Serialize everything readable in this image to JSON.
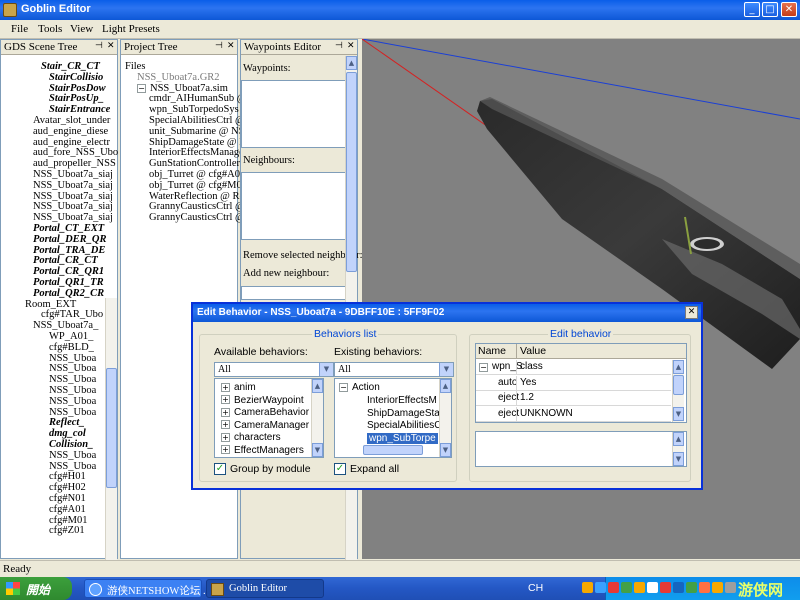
{
  "window": {
    "title": "Goblin Editor",
    "minimize": "_",
    "maximize": "□",
    "close": "✕"
  },
  "menu": [
    "File",
    "Tools",
    "View",
    "Light Presets"
  ],
  "scene_tree": {
    "title": "GDS Scene Tree",
    "items": [
      {
        "text": "Stair_CR_CT",
        "style": "bi",
        "indent": 1
      },
      {
        "text": "StairCollisio",
        "style": "bi",
        "indent": 2
      },
      {
        "text": "StairPosDow",
        "style": "bi",
        "indent": 2
      },
      {
        "text": "StairPosUp_",
        "style": "bi",
        "indent": 2
      },
      {
        "text": "StairEntrance",
        "style": "bi",
        "indent": 2
      },
      {
        "text": "Avatar_slot_under",
        "style": "n",
        "indent": 0
      },
      {
        "text": "aud_engine_diese",
        "style": "n",
        "indent": 0
      },
      {
        "text": "aud_engine_electr",
        "style": "n",
        "indent": 0
      },
      {
        "text": "aud_fore_NSS_Ubo",
        "style": "n",
        "indent": 0
      },
      {
        "text": "aud_propeller_NSS",
        "style": "n",
        "indent": 0
      },
      {
        "text": "NSS_Uboat7a_siaj",
        "style": "n",
        "indent": 0
      },
      {
        "text": "NSS_Uboat7a_siaj",
        "style": "n",
        "indent": 0
      },
      {
        "text": "NSS_Uboat7a_siaj",
        "style": "n",
        "indent": 0
      },
      {
        "text": "NSS_Uboat7a_siaj",
        "style": "n",
        "indent": 0
      },
      {
        "text": "NSS_Uboat7a_siaj",
        "style": "n",
        "indent": 0
      },
      {
        "text": "Portal_CT_EXT",
        "style": "bi",
        "indent": 0
      },
      {
        "text": "Portal_DER_QR",
        "style": "bi",
        "indent": 0
      },
      {
        "text": "Portal_TRA_DE",
        "style": "bi",
        "indent": 0
      },
      {
        "text": "Portal_CR_CT",
        "style": "bi",
        "indent": 0
      },
      {
        "text": "Portal_CR_QR1",
        "style": "bi",
        "indent": 0
      },
      {
        "text": "Portal_QR1_TR",
        "style": "bi",
        "indent": 0
      },
      {
        "text": "Portal_QR2_CR",
        "style": "bi",
        "indent": 0
      },
      {
        "text": "Room_EXT",
        "style": "n",
        "indent": -1
      },
      {
        "text": "cfg#TAR_Ubo",
        "style": "n",
        "indent": 1
      },
      {
        "text": "NSS_Uboat7a_",
        "style": "n",
        "indent": 0
      },
      {
        "text": "WP_A01_",
        "style": "n",
        "indent": 2
      },
      {
        "text": "cfg#BLD_",
        "style": "n",
        "indent": 2
      },
      {
        "text": "NSS_Uboa",
        "style": "n",
        "indent": 2
      },
      {
        "text": "NSS_Uboa",
        "style": "n",
        "indent": 2
      },
      {
        "text": "NSS_Uboa",
        "style": "n",
        "indent": 2
      },
      {
        "text": "NSS_Uboa",
        "style": "n",
        "indent": 2
      },
      {
        "text": "NSS_Uboa",
        "style": "n",
        "indent": 2
      },
      {
        "text": "NSS_Uboa",
        "style": "n",
        "indent": 2
      },
      {
        "text": "Reflect_",
        "style": "bi",
        "indent": 2
      },
      {
        "text": "dmg_col",
        "style": "bi",
        "indent": 2
      },
      {
        "text": "Collision_",
        "style": "bi",
        "indent": 2
      },
      {
        "text": "NSS_Uboa",
        "style": "n",
        "indent": 2
      },
      {
        "text": "NSS_Uboa",
        "style": "n",
        "indent": 2
      },
      {
        "text": "cfg#H01",
        "style": "n",
        "indent": 2
      },
      {
        "text": "cfg#H02",
        "style": "n",
        "indent": 2
      },
      {
        "text": "cfg#N01",
        "style": "n",
        "indent": 2
      },
      {
        "text": "cfg#A01",
        "style": "n",
        "indent": 2
      },
      {
        "text": "cfg#M01",
        "style": "n",
        "indent": 2
      },
      {
        "text": "cfg#Z01",
        "style": "n",
        "indent": 2
      }
    ]
  },
  "project_tree": {
    "title": "Project Tree",
    "items": [
      {
        "text": "Files",
        "indent": 0,
        "color": "#000"
      },
      {
        "text": "NSS_Uboat7a.GR2",
        "indent": 1,
        "color": "#7a7a7a"
      },
      {
        "text": "NSS_Uboat7a.sim",
        "indent": 1,
        "color": "#000",
        "toggle": "−"
      },
      {
        "text": "cmdr_AIHumanSub @",
        "indent": 2,
        "color": "#000"
      },
      {
        "text": "wpn_SubTorpedoSys",
        "indent": 2,
        "color": "#000"
      },
      {
        "text": "SpecialAbilitiesCtrl @",
        "indent": 2,
        "color": "#000"
      },
      {
        "text": "unit_Submarine @ NS",
        "indent": 2,
        "color": "#000"
      },
      {
        "text": "ShipDamageState @ N",
        "indent": 2,
        "color": "#000"
      },
      {
        "text": "InteriorEffectsManage",
        "indent": 2,
        "color": "#000"
      },
      {
        "text": "GunStationControllerI",
        "indent": 2,
        "color": "#000"
      },
      {
        "text": "obj_Turret @ cfg#A01",
        "indent": 2,
        "color": "#000"
      },
      {
        "text": "obj_Turret @ cfg#M01",
        "indent": 2,
        "color": "#000"
      },
      {
        "text": "WaterReflection @ Re",
        "indent": 2,
        "color": "#000"
      },
      {
        "text": "GrannyCausticsCtrl @",
        "indent": 2,
        "color": "#000"
      },
      {
        "text": "GrannyCausticsCtrl @",
        "indent": 2,
        "color": "#000"
      }
    ]
  },
  "waypoints": {
    "title": "Waypoints Editor",
    "waypoints_label": "Waypoints:",
    "neighbours_label": "Neighbours:",
    "remove_label": "Remove selected neighbour:",
    "add_label": "Add new neighbour:"
  },
  "dialog": {
    "title": "Edit Behavior - NSS_Uboat7a - 9DBFF10E : 5FF9F02",
    "behaviors_list_label": "Behaviors list",
    "available_label": "Available behaviors:",
    "existing_label": "Existing behaviors:",
    "available_filter": "All",
    "existing_filter": "All",
    "available_items": [
      "anim",
      "BezierWaypoint",
      "CameraBehavior",
      "CameraManager",
      "characters",
      "EffectManagers"
    ],
    "existing_group": "Action",
    "existing_items": [
      "InteriorEffectsM",
      "ShipDamageSta",
      "SpecialAbilitiesC",
      "wpn_SubTorpe"
    ],
    "group_by_module": "Group by module",
    "expand_all": "Expand all",
    "edit_behavior_label": "Edit behavior",
    "grid_headers": [
      "Name",
      "Value"
    ],
    "grid_rows": [
      {
        "name": "wpn_S",
        "value": "class"
      },
      {
        "name": "auto",
        "value": "Yes"
      },
      {
        "name": "eject",
        "value": "1.2"
      },
      {
        "name": "eject",
        "value": "UNKNOWN"
      }
    ]
  },
  "status": "Ready",
  "taskbar": {
    "start": "開始",
    "tasks": [
      "游侠NETSHOW论坛 ...",
      "Goblin Editor"
    ],
    "tray_lang": "CH",
    "watermark": "游侠网"
  },
  "colors": {
    "titlebar": "#0a5ee8",
    "viewport_bg": "#818181",
    "selected": "#316ac5"
  }
}
